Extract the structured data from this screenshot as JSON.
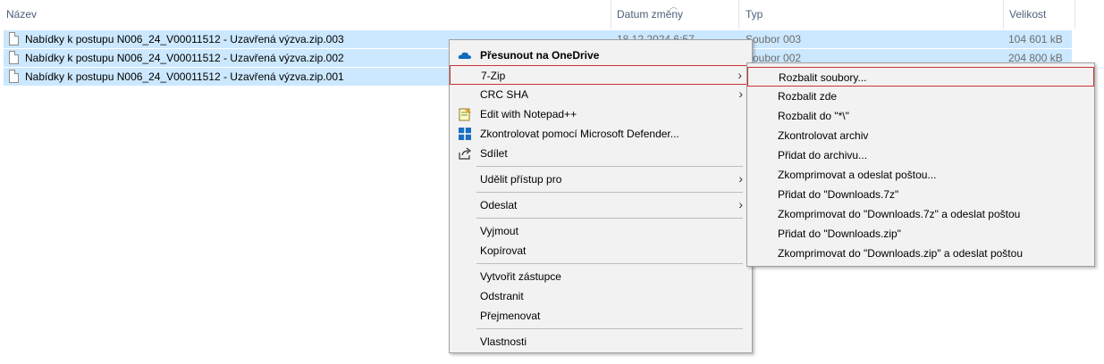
{
  "columns": {
    "name": "Název",
    "date": "Datum změny",
    "type": "Typ",
    "size": "Velikost"
  },
  "files": [
    {
      "name": "Nabídky k postupu N006_24_V00011512 - Uzavřená výzva.zip.003",
      "date": "18.12.2024 6:57",
      "type": "Soubor 003",
      "size": "104 601 kB"
    },
    {
      "name": "Nabídky k postupu N006_24_V00011512 - Uzavřená výzva.zip.002",
      "date": "",
      "type": "Soubor 002",
      "size": "204 800 kB"
    },
    {
      "name": "Nabídky k postupu N006_24_V00011512 - Uzavřená výzva.zip.001",
      "date": "",
      "type": "",
      "size": ""
    }
  ],
  "context_menu": {
    "onedrive": "Přesunout na OneDrive",
    "sevenzip": "7-Zip",
    "crcsha": "CRC SHA",
    "notepad": "Edit with Notepad++",
    "defender": "Zkontrolovat pomocí Microsoft Defender...",
    "share": "Sdílet",
    "grant_access": "Udělit přístup pro",
    "send_to": "Odeslat",
    "cut": "Vyjmout",
    "copy": "Kopírovat",
    "create_shortcut": "Vytvořit zástupce",
    "delete": "Odstranit",
    "rename": "Přejmenovat",
    "properties": "Vlastnosti"
  },
  "submenu_7zip": [
    "Rozbalit soubory...",
    "Rozbalit zde",
    "Rozbalit do \"*\\\"",
    "Zkontrolovat archiv",
    "Přidat do archivu...",
    "Zkomprimovat a odeslat poštou...",
    "Přidat do \"Downloads.7z\"",
    "Zkomprimovat do \"Downloads.7z\" a odeslat poštou",
    "Přidat do \"Downloads.zip\"",
    "Zkomprimovat do \"Downloads.zip\" a odeslat poštou"
  ],
  "colors": {
    "selection": "#cce8ff",
    "highlight_border": "#cc3333",
    "menu_bg": "#f2f2f2",
    "onedrive_blue": "#0f6cbd"
  }
}
